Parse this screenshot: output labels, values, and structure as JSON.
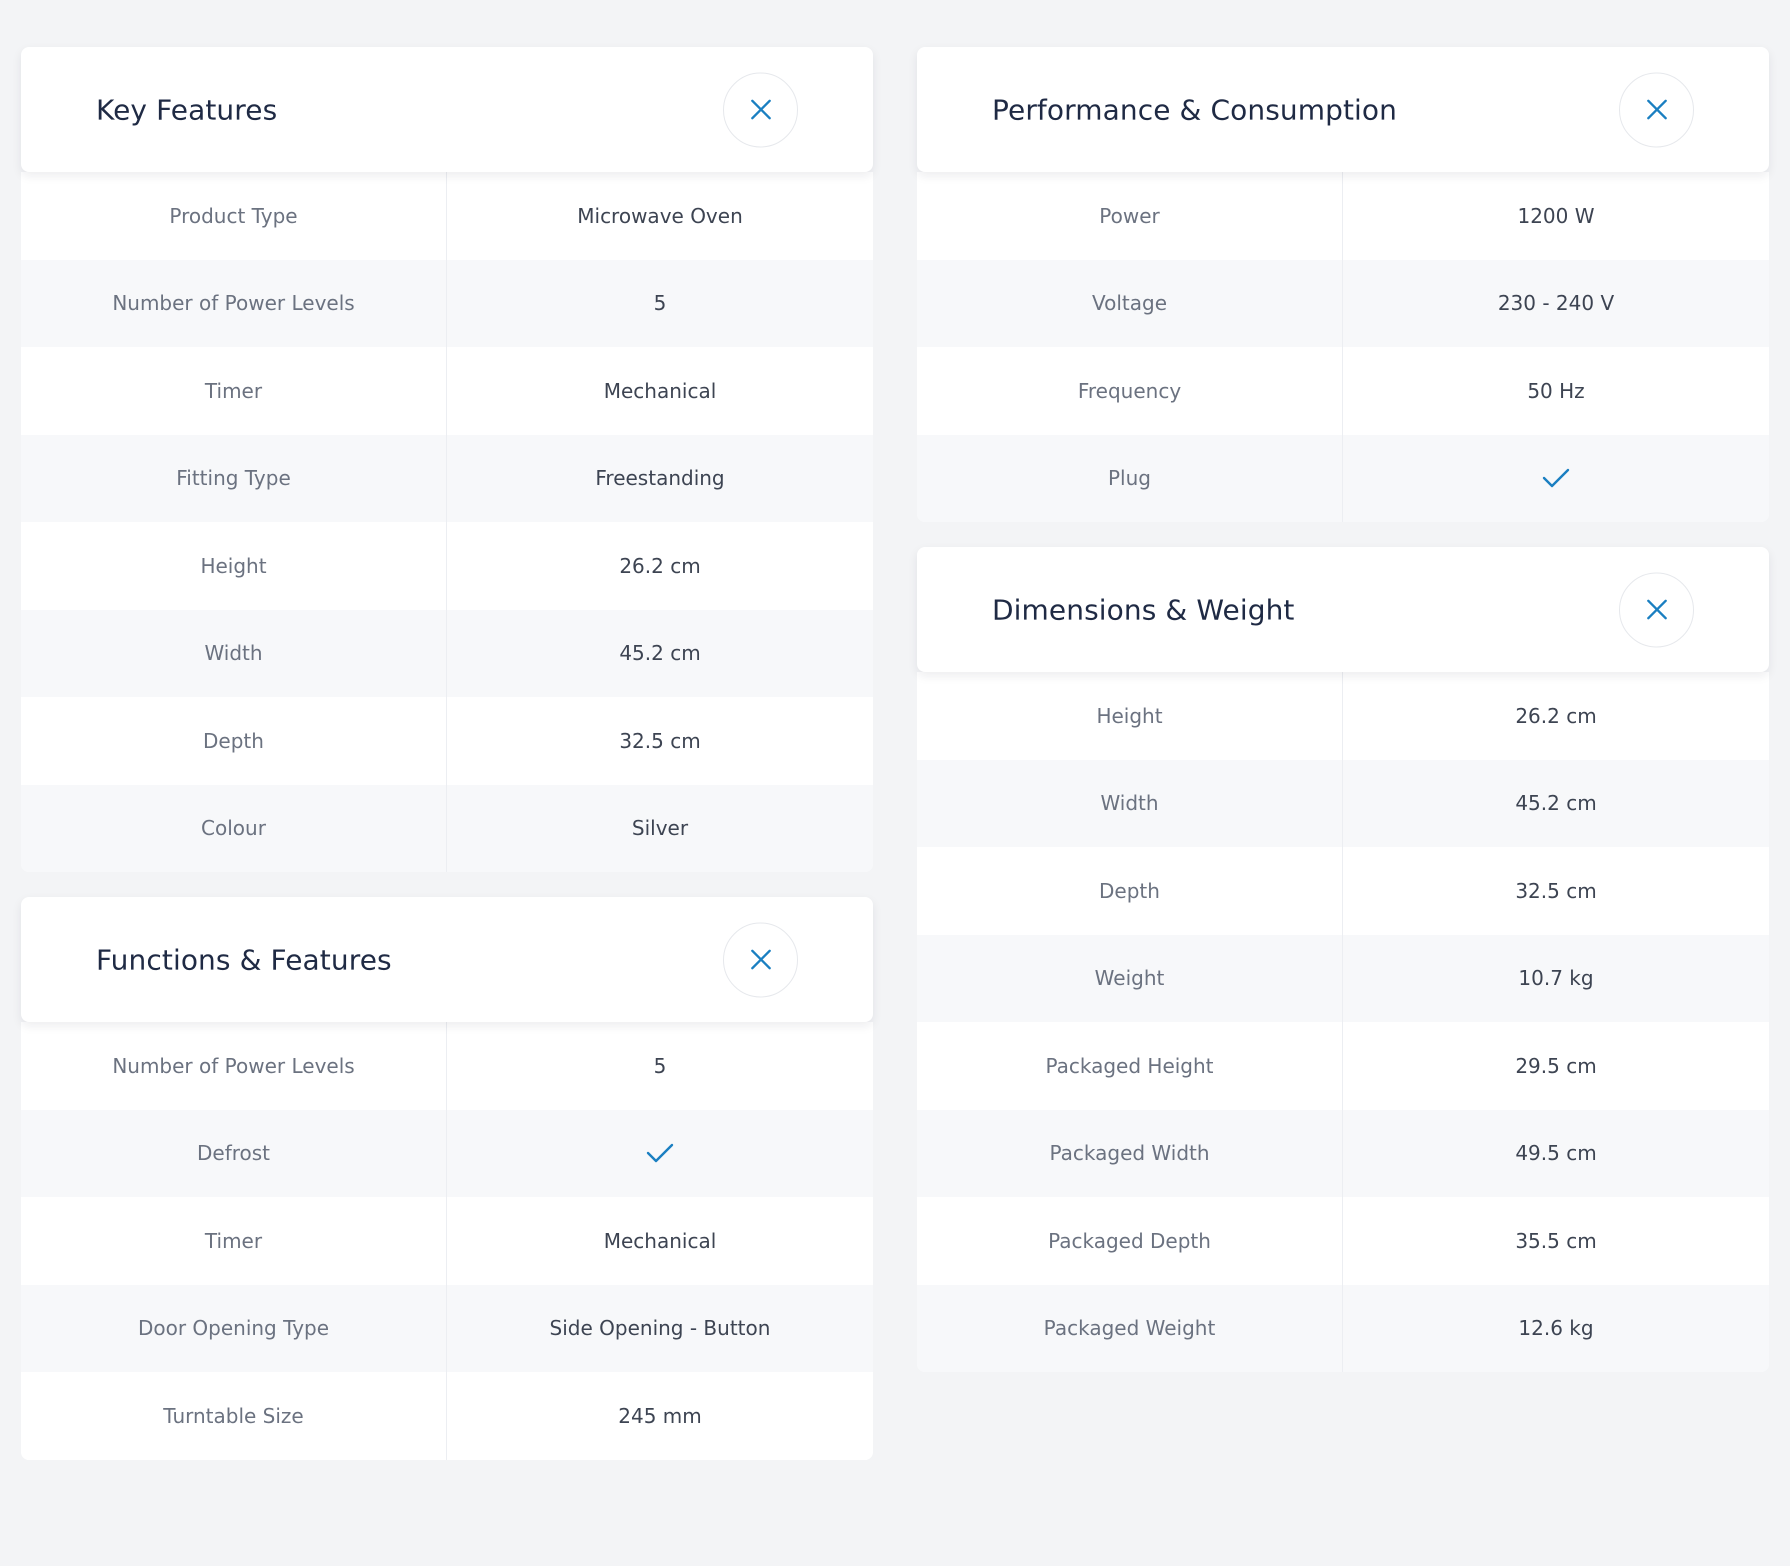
{
  "colors": {
    "accent": "#1a7fc1",
    "background": "#f3f4f6"
  },
  "icons": {
    "close": "close-x-icon",
    "check": "checkmark-icon"
  },
  "key_features": {
    "title": "Key Features",
    "rows": [
      {
        "label": "Product Type",
        "value": "Microwave Oven"
      },
      {
        "label": "Number of Power Levels",
        "value": "5"
      },
      {
        "label": "Timer",
        "value": "Mechanical"
      },
      {
        "label": "Fitting Type",
        "value": "Freestanding"
      },
      {
        "label": "Height",
        "value": "26.2 cm"
      },
      {
        "label": "Width",
        "value": "45.2 cm"
      },
      {
        "label": "Depth",
        "value": "32.5 cm"
      },
      {
        "label": "Colour",
        "value": "Silver"
      }
    ]
  },
  "functions_features": {
    "title": "Functions & Features",
    "rows": [
      {
        "label": "Number of Power Levels",
        "value": "5"
      },
      {
        "label": "Defrost",
        "value": ""
      },
      {
        "label": "Timer",
        "value": "Mechanical"
      },
      {
        "label": "Door Opening Type",
        "value": "Side Opening - Button"
      },
      {
        "label": "Turntable Size",
        "value": "245 mm"
      }
    ]
  },
  "performance": {
    "title": "Performance & Consumption",
    "rows": [
      {
        "label": "Power",
        "value": "1200 W"
      },
      {
        "label": "Voltage",
        "value": "230 - 240 V"
      },
      {
        "label": "Frequency",
        "value": "50 Hz"
      },
      {
        "label": "Plug",
        "value": ""
      }
    ]
  },
  "dimensions": {
    "title": "Dimensions & Weight",
    "rows": [
      {
        "label": "Height",
        "value": "26.2 cm"
      },
      {
        "label": "Width",
        "value": "45.2 cm"
      },
      {
        "label": "Depth",
        "value": "32.5 cm"
      },
      {
        "label": "Weight",
        "value": "10.7 kg"
      },
      {
        "label": "Packaged Height",
        "value": "29.5 cm"
      },
      {
        "label": "Packaged Width",
        "value": "49.5 cm"
      },
      {
        "label": "Packaged Depth",
        "value": "35.5 cm"
      },
      {
        "label": "Packaged Weight",
        "value": "12.6 kg"
      }
    ]
  }
}
